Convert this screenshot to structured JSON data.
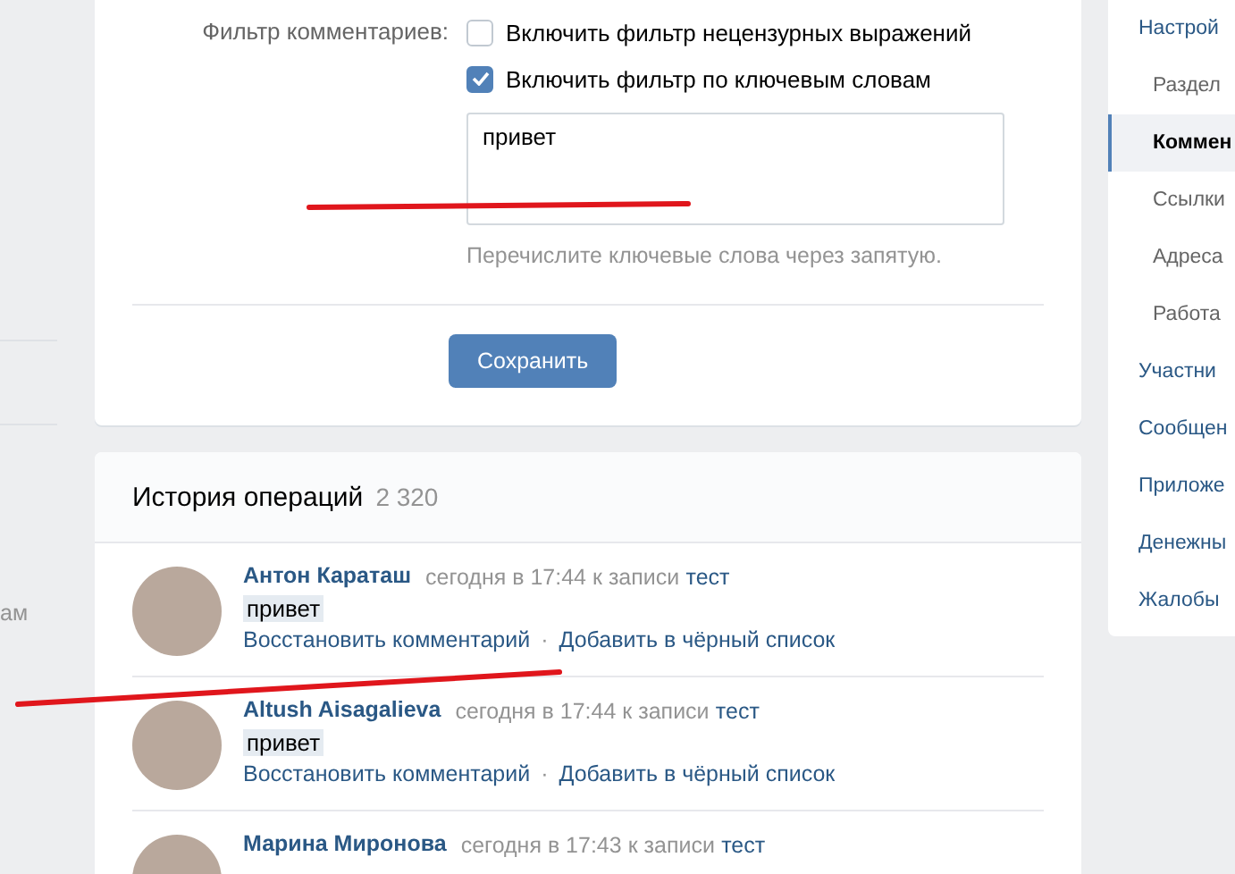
{
  "left_strip": {
    "text": "ам"
  },
  "comment_settings": {
    "filter_label": "Фильтр комментариев:",
    "filters": [
      {
        "label": "Включить фильтр нецензурных выражений",
        "checked": false
      },
      {
        "label": "Включить фильтр по ключевым словам",
        "checked": true
      }
    ],
    "keywords": {
      "value": "привет"
    },
    "hint": "Перечислите ключевые слова через запятую.",
    "save_button": "Сохранить"
  },
  "history": {
    "title": "История операций",
    "count": "2 320",
    "entries": [
      {
        "author": "Антон Караташ",
        "time": "сегодня в 17:44",
        "to_post": "к записи",
        "post": "тест",
        "text": "привет",
        "separator": "·",
        "actions": [
          "Восстановить комментарий",
          "Добавить в чёрный список"
        ]
      },
      {
        "author": "Altush Aisagalieva",
        "time": "сегодня в 17:44",
        "to_post": "к записи",
        "post": "тест",
        "text": "привет",
        "separator": "·",
        "actions": [
          "Восстановить комментарий",
          "Добавить в чёрный список"
        ]
      },
      {
        "author": "Марина Миронова",
        "time": "сегодня в 17:43",
        "to_post": "к записи",
        "post": "тест"
      }
    ]
  },
  "nav": [
    {
      "label": "Настрой",
      "kind": "main",
      "selected": false
    },
    {
      "label": "Раздел",
      "kind": "sub",
      "selected": false
    },
    {
      "label": "Коммен",
      "kind": "sub",
      "selected": true
    },
    {
      "label": "Ссылки",
      "kind": "sub",
      "selected": false
    },
    {
      "label": "Адреса",
      "kind": "sub",
      "selected": false
    },
    {
      "label": "Работа",
      "kind": "sub",
      "selected": false
    },
    {
      "label": "Участни",
      "kind": "main",
      "selected": false
    },
    {
      "label": "Сообщен",
      "kind": "main",
      "selected": false
    },
    {
      "label": "Приложе",
      "kind": "main",
      "selected": false
    },
    {
      "label": "Денежны",
      "kind": "main",
      "selected": false
    },
    {
      "label": "Жалобы",
      "kind": "main",
      "selected": false
    }
  ]
}
